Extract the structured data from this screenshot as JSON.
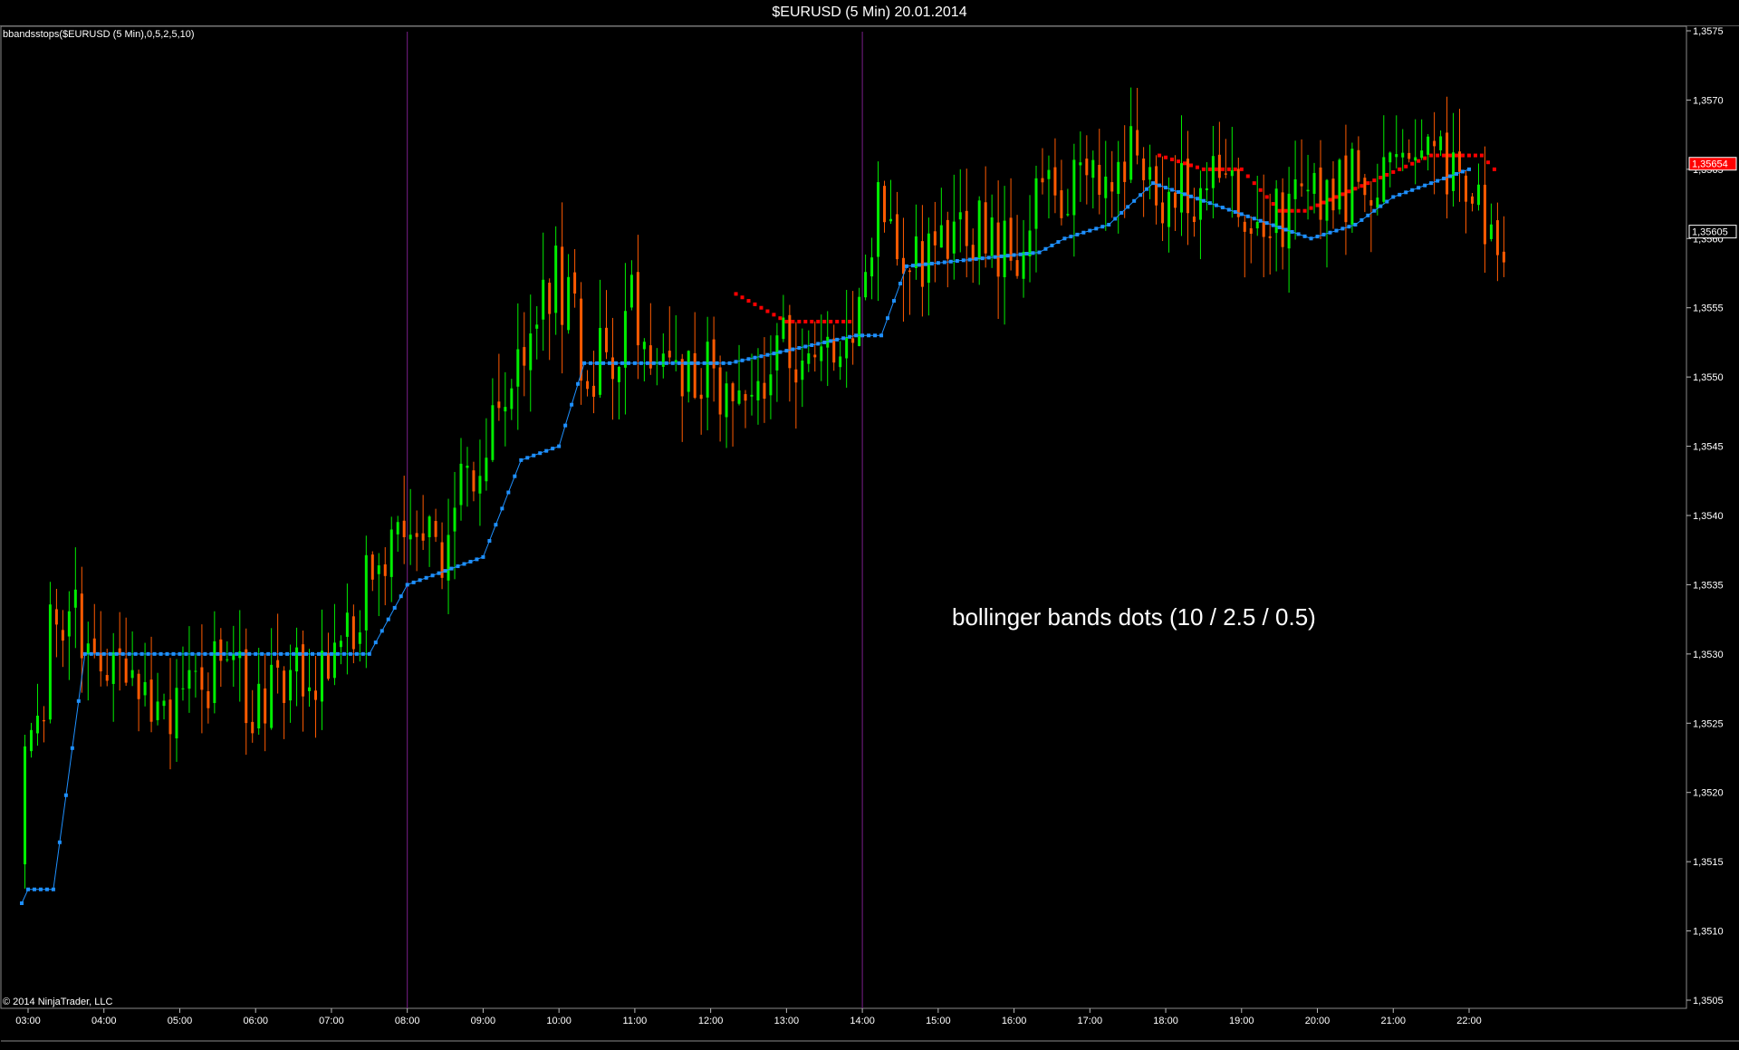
{
  "window": {
    "title": "$EURUSD (5 Min)  20.01.2014"
  },
  "indicator_label": "bbandsstops($EURUSD (5 Min),0,5,2,5,10)",
  "copyright": "© 2014 NinjaTrader, LLC",
  "annotation": "bollinger bands dots (10 / 2.5 / 0.5)",
  "chart_data": {
    "type": "candlestick",
    "symbol": "$EURUSD",
    "interval": "5 Min",
    "date": "20.01.2014",
    "y_axis": {
      "ticks": [
        "1,3575",
        "1,3570",
        "1,3565",
        "1,3560",
        "1,3555",
        "1,3550",
        "1,3545",
        "1,3540",
        "1,3535",
        "1,3530",
        "1,3525",
        "1,3520",
        "1,3515",
        "1,3510",
        "1,3505"
      ],
      "range": [
        1.3505,
        1.3575
      ]
    },
    "x_axis": {
      "ticks": [
        "03:00",
        "04:00",
        "05:00",
        "06:00",
        "07:00",
        "08:00",
        "09:00",
        "10:00",
        "11:00",
        "12:00",
        "13:00",
        "14:00",
        "15:00",
        "16:00",
        "17:00",
        "18:00",
        "19:00",
        "20:00",
        "21:00",
        "22:00"
      ]
    },
    "session_breaks": [
      "08:00",
      "14:00"
    ],
    "price_markers": [
      {
        "label": "1,35654",
        "value": 1.35654,
        "color": "#ff0000"
      },
      {
        "label": "1,35605",
        "value": 1.35605,
        "color": "#000000"
      }
    ],
    "colors": {
      "up": "#00ee00",
      "down": "#ff5a00",
      "support": "#1e90ff",
      "resistance": "#ff0000"
    },
    "close_path": [
      [
        "02:55",
        1.3515
      ],
      [
        "03:05",
        1.3527
      ],
      [
        "03:15",
        1.3525
      ],
      [
        "03:20",
        1.3535
      ],
      [
        "03:30",
        1.3531
      ],
      [
        "03:40",
        1.3533
      ],
      [
        "04:00",
        1.3529
      ],
      [
        "04:30",
        1.3528
      ],
      [
        "05:00",
        1.3526
      ],
      [
        "05:30",
        1.3529
      ],
      [
        "06:00",
        1.3527
      ],
      [
        "06:30",
        1.3528
      ],
      [
        "07:00",
        1.3529
      ],
      [
        "07:30",
        1.3535
      ],
      [
        "08:00",
        1.3538
      ],
      [
        "08:30",
        1.3537
      ],
      [
        "09:00",
        1.3545
      ],
      [
        "09:30",
        1.3552
      ],
      [
        "10:00",
        1.3557
      ],
      [
        "10:30",
        1.355
      ],
      [
        "11:00",
        1.3555
      ],
      [
        "11:30",
        1.3549
      ],
      [
        "12:00",
        1.3551
      ],
      [
        "12:20",
        1.3549
      ],
      [
        "12:30",
        1.3547
      ],
      [
        "13:00",
        1.3552
      ],
      [
        "13:30",
        1.3553
      ],
      [
        "14:00",
        1.3555
      ],
      [
        "14:15",
        1.3564
      ],
      [
        "14:30",
        1.356
      ],
      [
        "15:00",
        1.3558
      ],
      [
        "15:30",
        1.3561
      ],
      [
        "16:00",
        1.3559
      ],
      [
        "16:30",
        1.3563
      ],
      [
        "17:00",
        1.3564
      ],
      [
        "17:30",
        1.3566
      ],
      [
        "18:00",
        1.3563
      ],
      [
        "18:30",
        1.3564
      ],
      [
        "19:00",
        1.3562
      ],
      [
        "19:30",
        1.3561
      ],
      [
        "20:00",
        1.3563
      ],
      [
        "20:30",
        1.3564
      ],
      [
        "21:00",
        1.3565
      ],
      [
        "21:30",
        1.3566
      ],
      [
        "22:00",
        1.3565
      ],
      [
        "22:15",
        1.3561
      ]
    ],
    "support_dots": [
      [
        "02:55",
        1.3512
      ],
      [
        "03:00",
        1.3513
      ],
      [
        "03:20",
        1.3513
      ],
      [
        "03:45",
        1.353
      ],
      [
        "07:30",
        1.353
      ],
      [
        "08:00",
        1.3535
      ],
      [
        "08:30",
        1.3536
      ],
      [
        "09:00",
        1.3537
      ],
      [
        "09:30",
        1.3544
      ],
      [
        "10:00",
        1.3545
      ],
      [
        "10:20",
        1.3551
      ],
      [
        "12:15",
        1.3551
      ],
      [
        "13:55",
        1.3553
      ],
      [
        "14:15",
        1.3553
      ],
      [
        "14:35",
        1.3558
      ],
      [
        "16:20",
        1.3559
      ],
      [
        "16:40",
        1.356
      ],
      [
        "17:15",
        1.3561
      ],
      [
        "17:50",
        1.3564
      ],
      [
        "19:55",
        1.356
      ],
      [
        "20:30",
        1.3561
      ],
      [
        "21:00",
        1.3563
      ],
      [
        "21:30",
        1.3564
      ],
      [
        "22:00",
        1.3565
      ]
    ],
    "resistance_dots": [
      [
        [
          "12:20",
          1.3556
        ],
        [
          "12:40",
          1.3555
        ],
        [
          "13:00",
          1.3554
        ],
        [
          "13:50",
          1.3554
        ]
      ],
      [
        [
          "17:55",
          1.3566
        ],
        [
          "18:30",
          1.3565
        ],
        [
          "19:00",
          1.3565
        ],
        [
          "19:30",
          1.3562
        ],
        [
          "19:50",
          1.3562
        ],
        [
          "21:30",
          1.3566
        ],
        [
          "22:10",
          1.3566
        ],
        [
          "22:20",
          1.3565
        ]
      ]
    ]
  }
}
